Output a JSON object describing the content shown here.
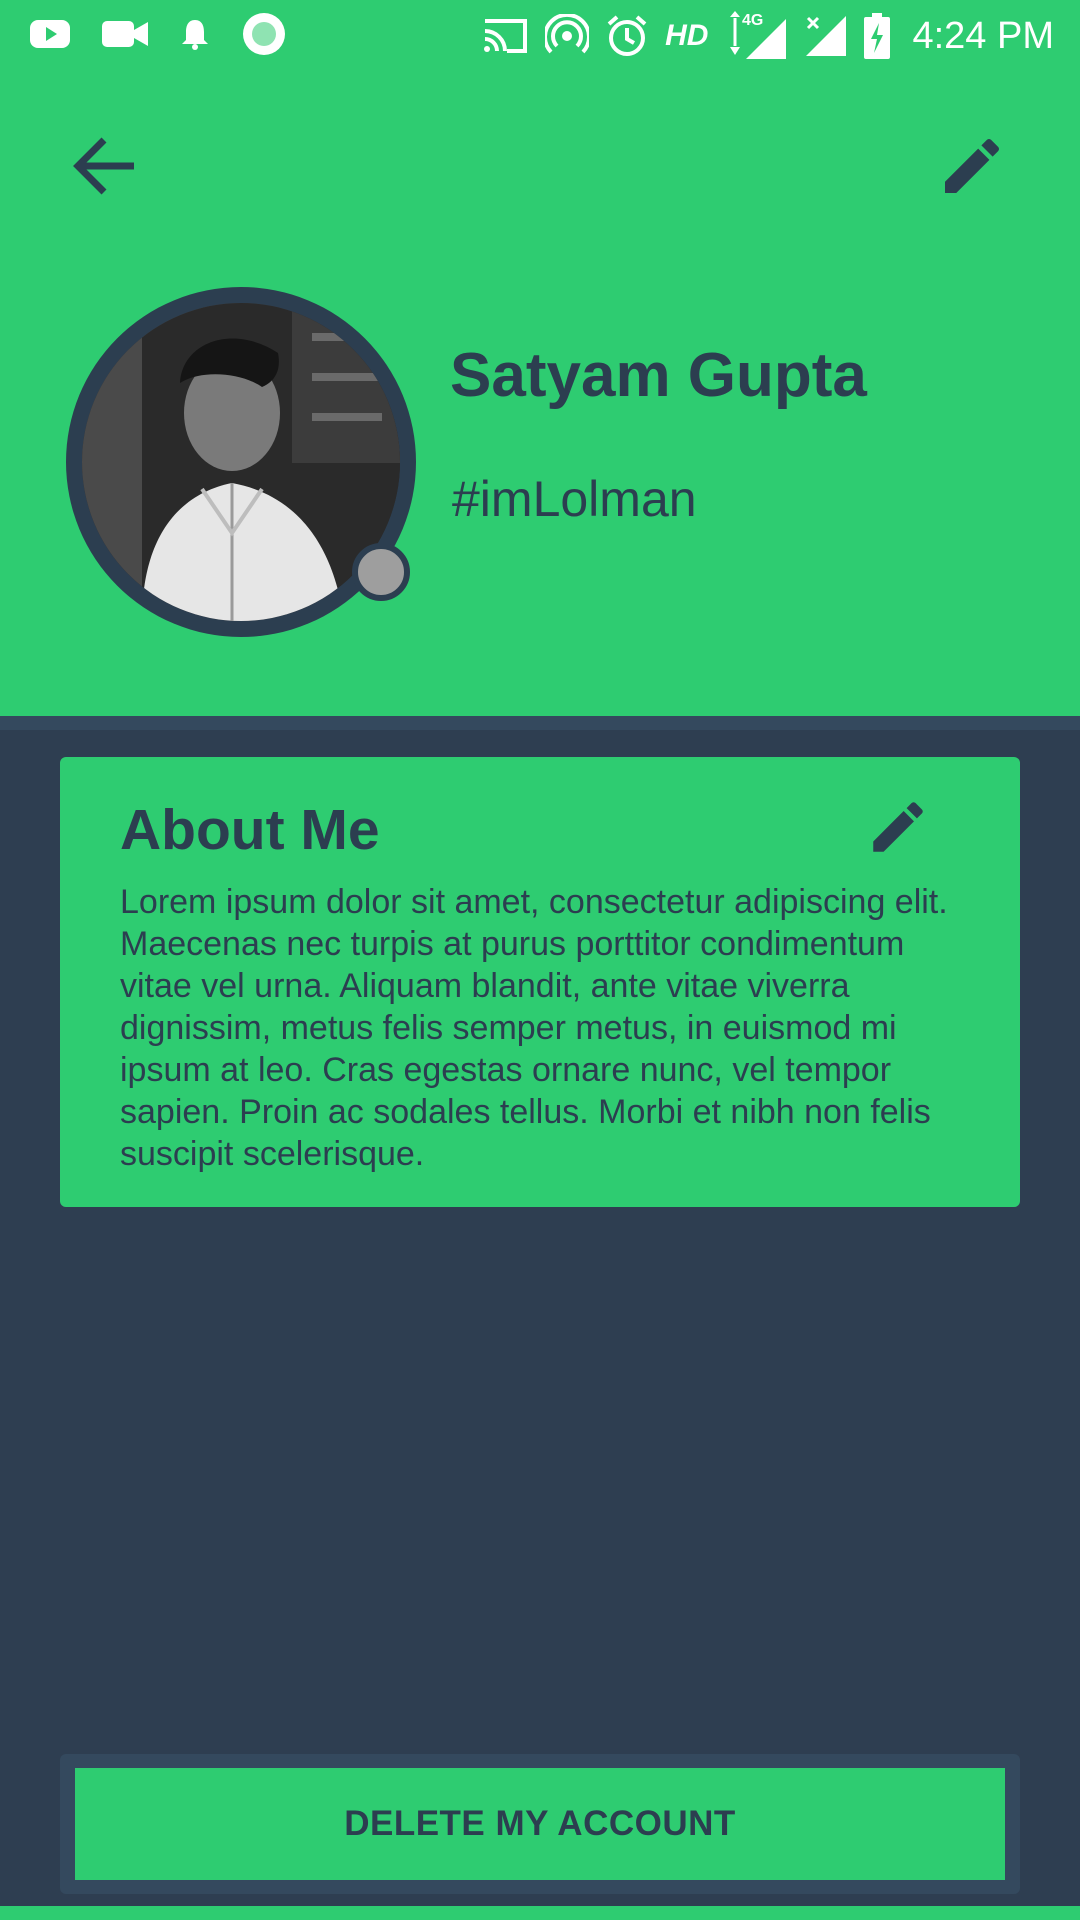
{
  "status_bar": {
    "time": "4:24 PM",
    "hd_label": "HD",
    "network_label": "4G",
    "left_icons": [
      "youtube-icon",
      "video-camera-icon",
      "notification-bell-icon",
      "record-icon"
    ],
    "right_icons": [
      "cast-icon",
      "hotspot-icon",
      "alarm-icon",
      "hd-icon",
      "signal-icon",
      "signal-no-data-icon",
      "battery-charging-icon"
    ]
  },
  "toolbar": {
    "back_icon": "arrow-back-icon",
    "edit_icon": "pencil-icon"
  },
  "profile": {
    "name": "Satyam Gupta",
    "tag": "#imLolman",
    "status_indicator_color": "#9e9e9e"
  },
  "about": {
    "title": "About Me",
    "text": "Lorem ipsum dolor sit amet, consectetur adipiscing elit. Maecenas nec turpis at purus porttitor condimentum vitae vel urna. Aliquam blandit, ante vitae viverra dignissim, metus felis semper metus, in euismod mi ipsum at leo. Cras egestas ornare nunc, vel tempor sapien. Proin ac sodales tellus. Morbi et nibh non felis suscipit scelerisque.",
    "edit_icon": "pencil-icon"
  },
  "actions": {
    "delete_label": "DELETE MY ACCOUNT"
  },
  "colors": {
    "accent_green": "#2ecc71",
    "dark_navy": "#2c3e50",
    "background": "#2e3e51"
  }
}
